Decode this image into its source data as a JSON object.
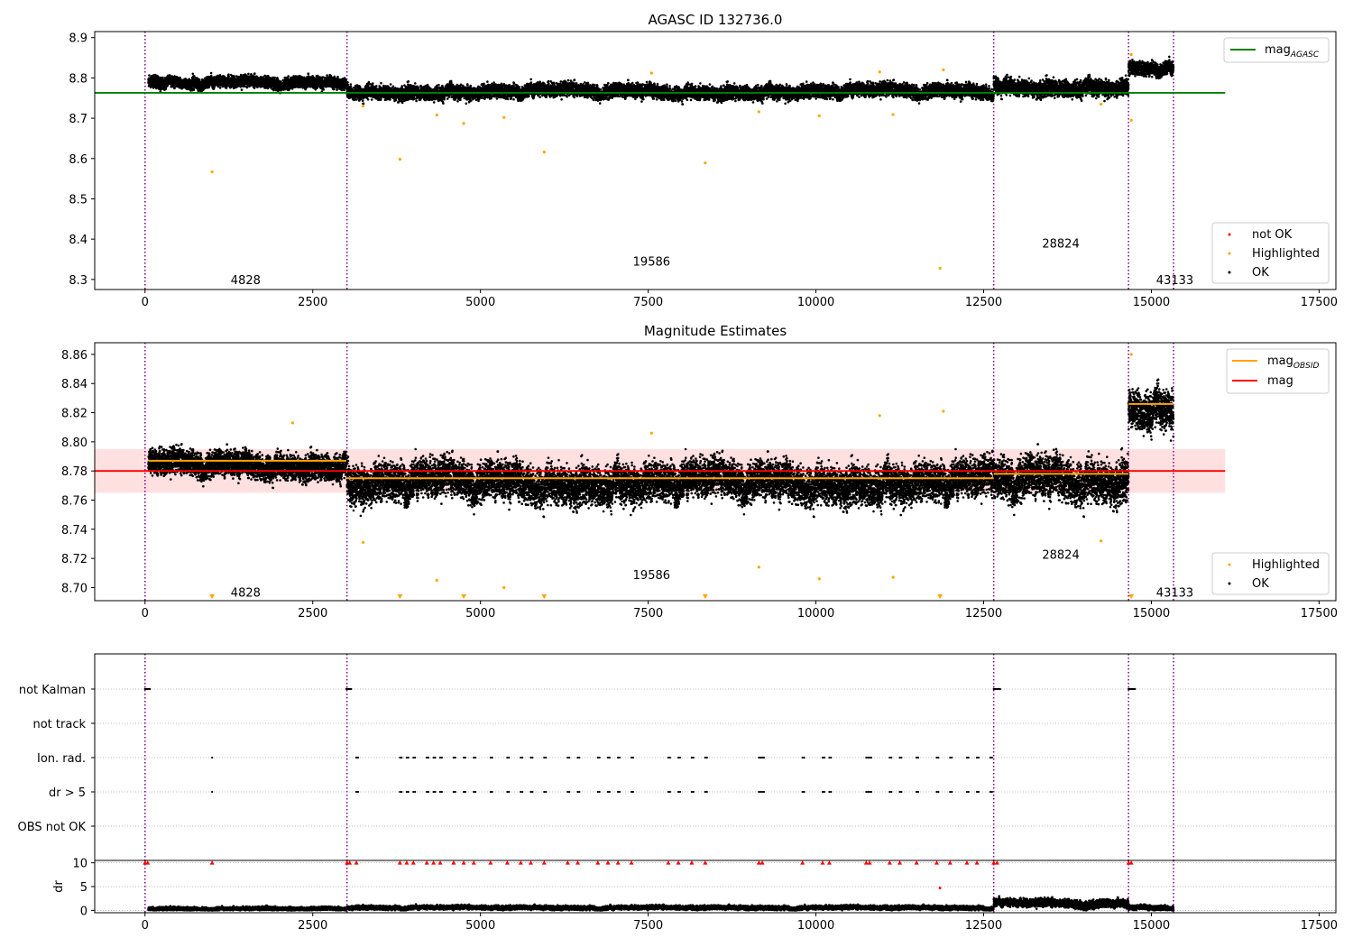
{
  "chart_data": [
    {
      "type": "scatter",
      "title": "AGASC ID 132736.0",
      "xlabel": "",
      "ylabel": "",
      "xlim": [
        -750,
        17750
      ],
      "ylim": [
        8.275,
        8.915
      ],
      "x_ticks": [
        0,
        2500,
        5000,
        7500,
        10000,
        12500,
        15000,
        17500
      ],
      "x_tick_labels": [
        "0",
        "2500",
        "5000",
        "7500",
        "10000",
        "12500",
        "15000",
        "17500"
      ],
      "y_ticks": [
        8.3,
        8.4,
        8.5,
        8.6,
        8.7,
        8.8,
        8.9
      ],
      "y_tick_labels": [
        "8.3",
        "8.4",
        "8.5",
        "8.6",
        "8.7",
        "8.8",
        "8.9"
      ],
      "obs_boundaries": [
        0,
        3010,
        12650,
        14660,
        15330
      ],
      "obs_labels": [
        {
          "text": "4828",
          "x": 1500,
          "y": 8.3
        },
        {
          "text": "19586",
          "x": 7550,
          "y": 8.345
        },
        {
          "text": "28824",
          "x": 13650,
          "y": 8.39
        },
        {
          "text": "43133",
          "x": 15350,
          "y": 8.3
        }
      ],
      "mag_agasc": {
        "value": 8.763,
        "x": [
          -750,
          16100
        ]
      },
      "segments": [
        {
          "x": [
            50,
            3000
          ],
          "center": 8.79,
          "spread": 0.01
        },
        {
          "x": [
            3010,
            12650
          ],
          "center": 8.77,
          "spread": 0.012
        },
        {
          "x": [
            12650,
            14660
          ],
          "center": 8.782,
          "spread": 0.014
        },
        {
          "x": [
            14660,
            15330
          ],
          "center": 8.826,
          "spread": 0.012
        }
      ],
      "highlighted_points": [
        [
          1000,
          8.567
        ],
        [
          3800,
          8.598
        ],
        [
          4350,
          8.708
        ],
        [
          4750,
          8.687
        ],
        [
          5350,
          8.702
        ],
        [
          5950,
          8.616
        ],
        [
          8350,
          8.589
        ],
        [
          9150,
          8.716
        ],
        [
          10050,
          8.706
        ],
        [
          11150,
          8.709
        ],
        [
          11850,
          8.328
        ],
        [
          3250,
          8.73
        ],
        [
          14250,
          8.735
        ],
        [
          14700,
          8.695
        ],
        [
          11900,
          8.82
        ],
        [
          10950,
          8.815
        ],
        [
          14700,
          8.858
        ],
        [
          7550,
          8.812
        ]
      ],
      "legend_top": [
        {
          "label": "mag",
          "sub": "AGASC",
          "color": "#008000"
        }
      ],
      "legend_bottom": [
        {
          "label": "not OK",
          "color": "#ff0000"
        },
        {
          "label": "Highlighted",
          "color": "#ffa500"
        },
        {
          "label": "OK",
          "color": "#000000"
        }
      ]
    },
    {
      "type": "scatter",
      "title": "Magnitude Estimates",
      "xlabel": "",
      "ylabel": "",
      "xlim": [
        -750,
        17750
      ],
      "ylim": [
        8.691,
        8.868
      ],
      "x_ticks": [
        0,
        2500,
        5000,
        7500,
        10000,
        12500,
        15000,
        17500
      ],
      "x_tick_labels": [
        "0",
        "2500",
        "5000",
        "7500",
        "10000",
        "12500",
        "15000",
        "17500"
      ],
      "y_ticks": [
        8.7,
        8.72,
        8.74,
        8.76,
        8.78,
        8.8,
        8.82,
        8.84,
        8.86
      ],
      "y_tick_labels": [
        "8.70",
        "8.72",
        "8.74",
        "8.76",
        "8.78",
        "8.80",
        "8.82",
        "8.84",
        "8.86"
      ],
      "obs_boundaries": [
        0,
        3010,
        12650,
        14660,
        15330
      ],
      "obs_labels": [
        {
          "text": "4828",
          "x": 1500,
          "y": 8.697
        },
        {
          "text": "19586",
          "x": 7550,
          "y": 8.709
        },
        {
          "text": "28824",
          "x": 13650,
          "y": 8.723
        },
        {
          "text": "43133",
          "x": 15350,
          "y": 8.697
        }
      ],
      "mag": {
        "value": 8.78,
        "band": [
          8.765,
          8.795
        ],
        "x": [
          -750,
          16100
        ]
      },
      "mag_obsid": [
        {
          "x": [
            50,
            3000
          ],
          "value": 8.787
        },
        {
          "x": [
            3010,
            12650
          ],
          "value": 8.775
        },
        {
          "x": [
            12650,
            14660
          ],
          "value": 8.778
        },
        {
          "x": [
            14660,
            15330
          ],
          "value": 8.826
        }
      ],
      "segments": [
        {
          "x": [
            50,
            3000
          ],
          "center": 8.786,
          "spread": 0.006
        },
        {
          "x": [
            3010,
            12650
          ],
          "center": 8.775,
          "spread": 0.009
        },
        {
          "x": [
            12650,
            14660
          ],
          "center": 8.778,
          "spread": 0.01
        },
        {
          "x": [
            14660,
            15330
          ],
          "center": 8.826,
          "spread": 0.009
        }
      ],
      "highlighted_points": [
        [
          4350,
          8.705
        ],
        [
          5350,
          8.7
        ],
        [
          9150,
          8.714
        ],
        [
          10050,
          8.706
        ],
        [
          11150,
          8.707
        ],
        [
          14250,
          8.732
        ],
        [
          3250,
          8.731
        ],
        [
          10950,
          8.818
        ],
        [
          11900,
          8.821
        ],
        [
          7550,
          8.806
        ],
        [
          14700,
          8.86
        ],
        [
          2200,
          8.813
        ]
      ],
      "clipped_markers_x": [
        1000,
        3800,
        4750,
        5950,
        8350,
        11850,
        14700
      ],
      "legend_top": [
        {
          "label": "mag",
          "sub": "OBSID",
          "color": "#ffa500"
        },
        {
          "label": "mag",
          "sub": "",
          "color": "#ff0000"
        }
      ],
      "legend_bottom": [
        {
          "label": "Highlighted",
          "color": "#ffa500"
        },
        {
          "label": "OK",
          "color": "#000000"
        }
      ]
    },
    {
      "type": "scatter",
      "title": "",
      "xlabel": "",
      "ylabel": "",
      "xlim": [
        -750,
        17750
      ],
      "categories": [
        "not Kalman",
        "not track",
        "Ion. rad.",
        "dr > 5",
        "OBS not OK"
      ],
      "obs_boundaries": [
        0,
        3010,
        12650,
        14660,
        15330
      ],
      "flag_rows": {
        "not Kalman": [
          [
            0,
            80
          ],
          [
            3000,
            3080
          ],
          [
            12650,
            12750
          ],
          [
            14660,
            14760
          ]
        ],
        "not track": [],
        "Ion. rad.": [
          1000,
          3150,
          3800,
          3900,
          4000,
          4200,
          4300,
          4400,
          4600,
          4750,
          4900,
          5150,
          5400,
          5600,
          5750,
          5950,
          6300,
          6450,
          6750,
          6900,
          7050,
          7250,
          7800,
          7950,
          8150,
          8350,
          9150,
          9200,
          9800,
          10100,
          10200,
          10750,
          10800,
          11100,
          11250,
          11500,
          11800,
          12000,
          12250,
          12400,
          12600
        ]
      }
    },
    {
      "type": "scatter",
      "title": "",
      "xlabel": "",
      "ylabel": "dr",
      "xlim": [
        -750,
        17750
      ],
      "ylim": [
        -0.5,
        10.5
      ],
      "y_ticks": [
        0,
        5,
        10
      ],
      "y_tick_labels": [
        "0",
        "5",
        "10"
      ],
      "x_ticks": [
        0,
        2500,
        5000,
        7500,
        10000,
        12500,
        15000,
        17500
      ],
      "x_tick_labels": [
        "0",
        "2500",
        "5000",
        "7500",
        "10000",
        "12500",
        "15000",
        "17500"
      ],
      "obs_boundaries": [
        0,
        3010,
        12650,
        14660,
        15330
      ],
      "segments": [
        {
          "x": [
            50,
            3000
          ],
          "center": 0.4,
          "spread": 0.25
        },
        {
          "x": [
            3010,
            12650
          ],
          "center": 0.6,
          "spread": 0.3
        },
        {
          "x": [
            12650,
            14660
          ],
          "center": 1.5,
          "spread": 0.6
        },
        {
          "x": [
            14660,
            15330
          ],
          "center": 0.6,
          "spread": 0.35
        }
      ],
      "clipped_red_x": [
        0,
        40,
        1000,
        3010,
        3050,
        3150,
        3800,
        3900,
        4000,
        4200,
        4300,
        4400,
        4600,
        4750,
        4900,
        5150,
        5400,
        5600,
        5750,
        5950,
        6300,
        6450,
        6750,
        6900,
        7050,
        7250,
        7800,
        7950,
        8150,
        8350,
        9150,
        9200,
        9800,
        10100,
        10200,
        10750,
        10800,
        11100,
        11250,
        11500,
        11800,
        12000,
        12250,
        12400,
        12650,
        12700,
        14660,
        14700
      ],
      "red_points": [
        [
          11850,
          4.7
        ]
      ]
    }
  ]
}
